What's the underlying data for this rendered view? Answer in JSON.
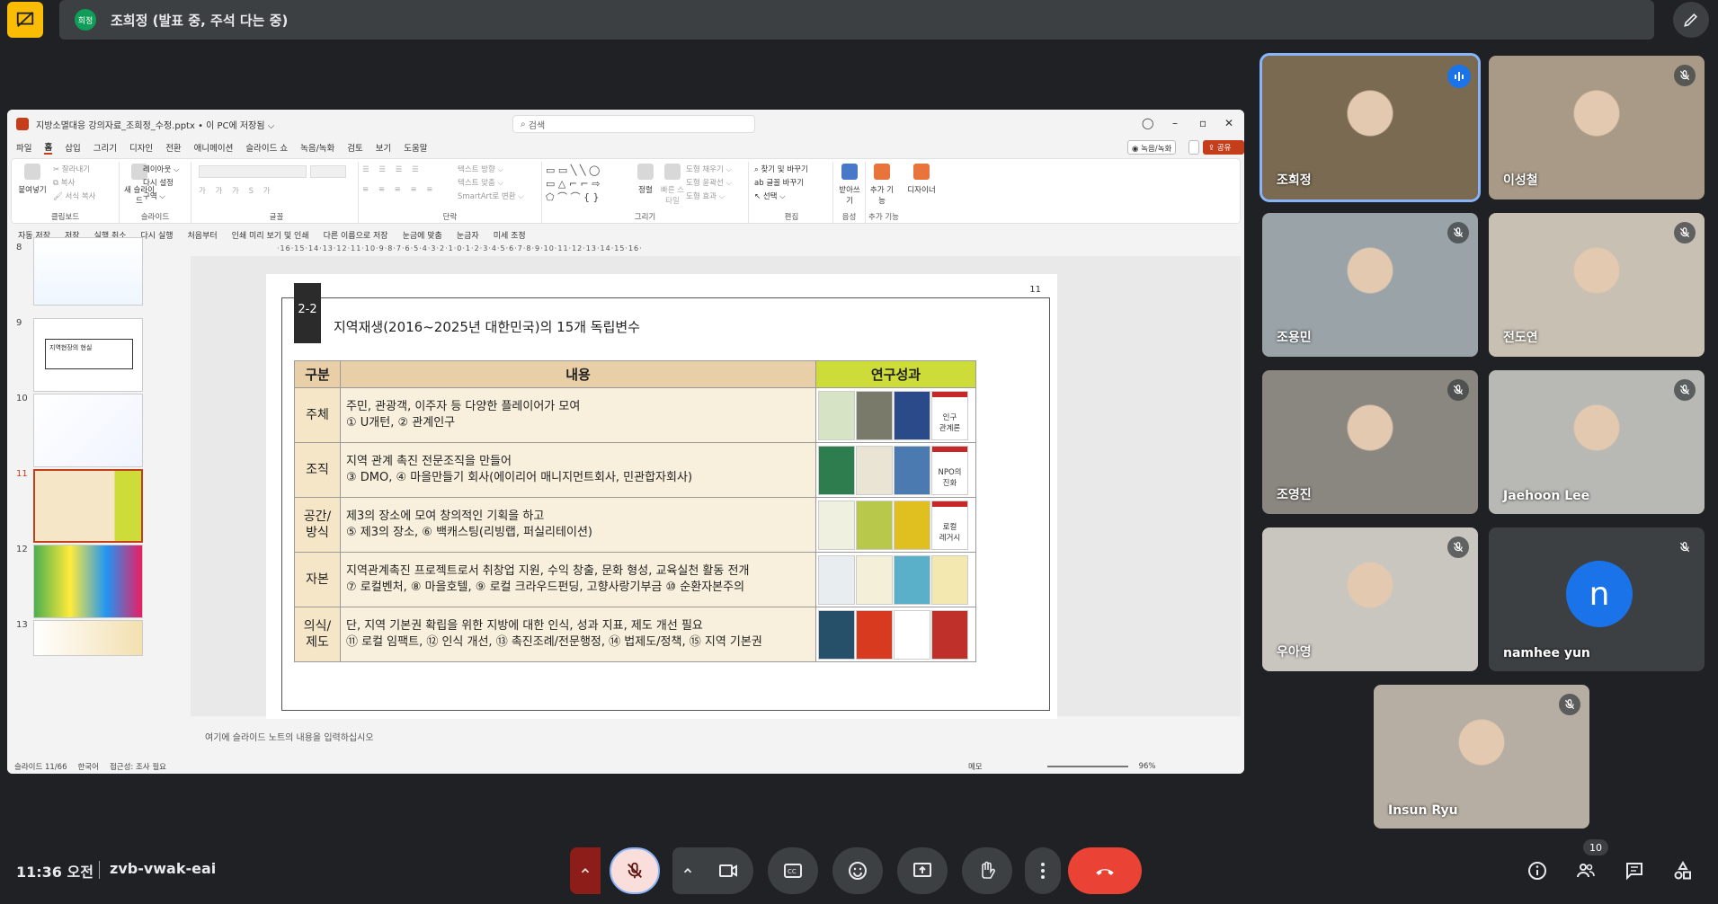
{
  "banner": {
    "presenter_avatar_label": "희정",
    "presenter_text": "조희정 (발표 중, 주석 다는 중)"
  },
  "ppt": {
    "window_title": "지방소멸대응 강의자료_조희정_수정.pptx • 이 PC에 저장됨 ⌵",
    "search_placeholder": "검색",
    "menu": [
      "파일",
      "홈",
      "삽입",
      "그리기",
      "디자인",
      "전환",
      "애니메이션",
      "슬라이드 쇼",
      "녹음/녹화",
      "검토",
      "보기",
      "도움말"
    ],
    "record_label": "◉ 녹음/녹화",
    "share_label": "⇪ 공유 ⌵",
    "ribbon": {
      "paste": "붙여넣기",
      "cut": "잘라내기",
      "copy": "복사",
      "format_painter": "서식 복사",
      "clipboard": "클립보드",
      "new_slide": "새 슬라이드",
      "layout": "레이아웃 ⌵",
      "reset": "다시 설정",
      "section": "구역 ⌵",
      "slides": "슬라이드",
      "font": "글꼴",
      "paragraph": "단락",
      "text_direction": "텍스트 방향 ⌵",
      "text_align": "텍스트 맞춤 ⌵",
      "smartart": "SmartArt로 변환 ⌵",
      "drawing": "그리기",
      "arrange": "정렬",
      "quick_styles": "빠른 스타일",
      "shape_fill": "도형 채우기 ⌵",
      "shape_outline": "도형 윤곽선 ⌵",
      "shape_effects": "도형 효과 ⌵",
      "find_replace": "찾기 및 바꾸기",
      "replace_font": "글꼴 바꾸기",
      "select": "선택 ⌵",
      "editing": "편집",
      "dictate": "받아쓰기",
      "voice": "음성",
      "addins": "추가 기능",
      "addins_group": "추가 기능",
      "designer": "디자이너"
    },
    "qat": [
      "자동 저장",
      "저장",
      "실행 취소",
      "다시 실행",
      "처음부터",
      "인쇄 미리 보기 및 인쇄",
      "다른 이름으로 저장",
      "눈금에 맞춤",
      "눈금자",
      "미세 조정"
    ],
    "thumb_numbers": [
      "8",
      "9",
      "10",
      "11",
      "12",
      "13"
    ],
    "thumb9_text": "지역현장의 현실",
    "ruler": "·16·15·14·13·12·11·10·9·8·7·6·5·4·3·2·1·0·1·2·3·4·5·6·7·8·9·10·11·12·13·14·15·16·",
    "notes_placeholder": "여기에 슬라이드 노트의 내용을 입력하십시오",
    "status": [
      "슬라이드 11/66",
      "한국어",
      "접근성: 조사 필요",
      "메모",
      "96%"
    ]
  },
  "slide": {
    "badge": "2-2",
    "page_number": "11",
    "title": "지역재생(2016~2025년 대한민국)의 15개 독립변수",
    "headers": [
      "구분",
      "내용",
      "연구성과"
    ],
    "rows": [
      {
        "cat": "주체",
        "line1": "주민, 관광객, 이주자 등 다양한 플레이어가 모여",
        "line2": "① U개턴, ② 관계인구",
        "books": [
          "#d7e3c5",
          "#7a7a6a",
          "#2a4a8a",
          "#ffffff"
        ]
      },
      {
        "cat": "조직",
        "line1": "지역 관계 촉진 전문조직을 만들어",
        "line2": "③ DMO, ④ 마을만들기 회사(에이리어 매니지먼트회사, 민관합자회사)",
        "books": [
          "#2e7d4f",
          "#e9e4d4",
          "#4a7ab0",
          "#ffffff"
        ]
      },
      {
        "cat": "공간/\n방식",
        "line1": "제3의 장소에 모여 창의적인 기획을 하고",
        "line2": "⑤ 제3의 장소, ⑥ 백캐스팅(리빙랩, 퍼실리테이션)",
        "books": [
          "#f0f0e0",
          "#b8c84a",
          "#e0c020",
          "#ffffff"
        ]
      },
      {
        "cat": "자본",
        "line1": "지역관계촉진 프로젝트로서 취창업 지원, 수익 창출, 문화 형성, 교육실천 활동 전개",
        "line2": "⑦ 로컬벤처, ⑧ 마을호텔, ⑨ 로컬 크라우드펀딩, 고향사랑기부금 ⑩ 순환자본주의",
        "books": [
          "#e8eef0",
          "#f4efd8",
          "#5ab0c8",
          "#f2e8b0"
        ]
      },
      {
        "cat": "의식/\n제도",
        "line1": "단, 지역 기본권 확립을 위한 지방에 대한 인식, 성과 지표, 제도 개선 필요",
        "line2": "⑪ 로컬 임팩트, ⑫ 인식 개선, ⑬ 촉진조례/전문행정, ⑭ 법제도/정책, ⑮ 지역 기본권",
        "books": [
          "#26506a",
          "#d83a20",
          "#ffffff",
          "#c0302a"
        ]
      }
    ],
    "book_labels": [
      "인구\n관계론",
      "NPO의\n진화",
      "로컬\n레거시"
    ]
  },
  "participants": [
    {
      "name": "조희정",
      "speaking": true,
      "bg": "#7a6a52"
    },
    {
      "name": "이성철",
      "bg": "#a89a86"
    },
    {
      "name": "조용민",
      "bg": "#9aa4a8"
    },
    {
      "name": "전도연",
      "bg": "#c8c0b2"
    },
    {
      "name": "조영진",
      "bg": "#8a8680"
    },
    {
      "name": "Jaehoon Lee",
      "bg": "#b8b8b4"
    },
    {
      "name": "우아영",
      "bg": "#c9c6c0"
    },
    {
      "name": "namhee yun",
      "initial": "n"
    },
    {
      "name": "Insun Ryu",
      "bg": "#b6aea2"
    }
  ],
  "meeting": {
    "time": "11:36 오전",
    "code": "zvb-vwak-eai",
    "people_count": "10"
  },
  "colors": {
    "accent": "#8ab4f8",
    "hangup": "#ea4335",
    "present": "#fbbc04",
    "ppt_accent": "#c43e1c"
  }
}
